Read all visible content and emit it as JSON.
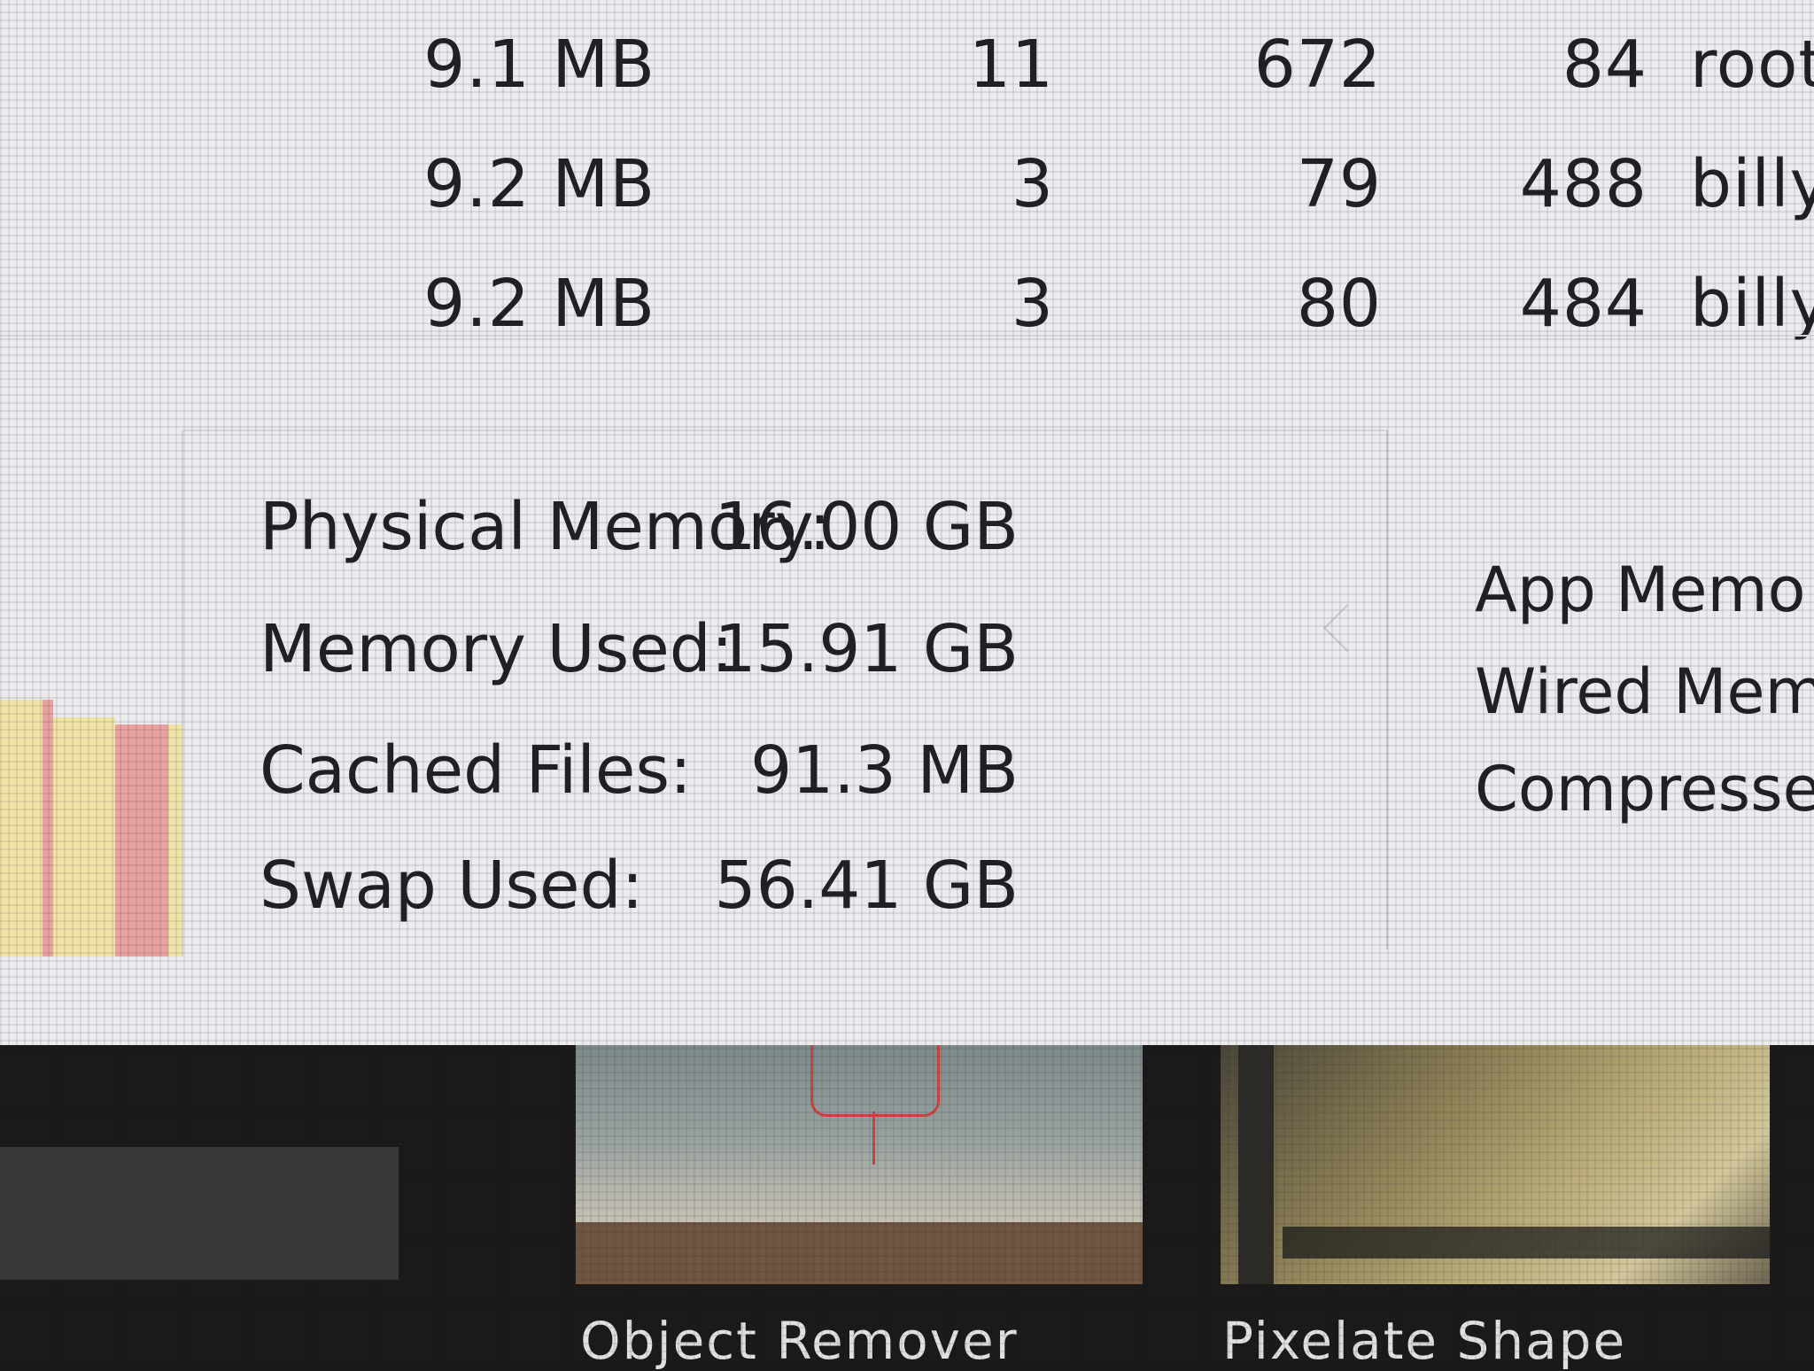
{
  "process_rows": [
    {
      "memory": "9.1 MB",
      "threads": "11",
      "ports": "672",
      "pid": "84",
      "user": "root"
    },
    {
      "memory": "9.2 MB",
      "threads": "3",
      "ports": "79",
      "pid": "488",
      "user": "billy"
    },
    {
      "memory": "9.2 MB",
      "threads": "3",
      "ports": "80",
      "pid": "484",
      "user": "billy"
    }
  ],
  "memory_stats": {
    "physical_label": "Physical Memory:",
    "physical_value": "16.00 GB",
    "used_label": "Memory Used:",
    "used_value": "15.91 GB",
    "cached_label": "Cached Files:",
    "cached_value": "91.3 MB",
    "swap_label": "Swap Used:",
    "swap_value": "56.41 GB"
  },
  "memory_breakdown": {
    "app_label": "App Memo",
    "wired_label": "Wired Mem",
    "compressed_label": "Compresse"
  },
  "thumbnails": {
    "object_remover_label": "Object Remover",
    "pixelate_label": "Pixelate Shape"
  },
  "colors": {
    "pressure_yellow": "#f1e3a6",
    "pressure_red": "#e8a3a0"
  }
}
